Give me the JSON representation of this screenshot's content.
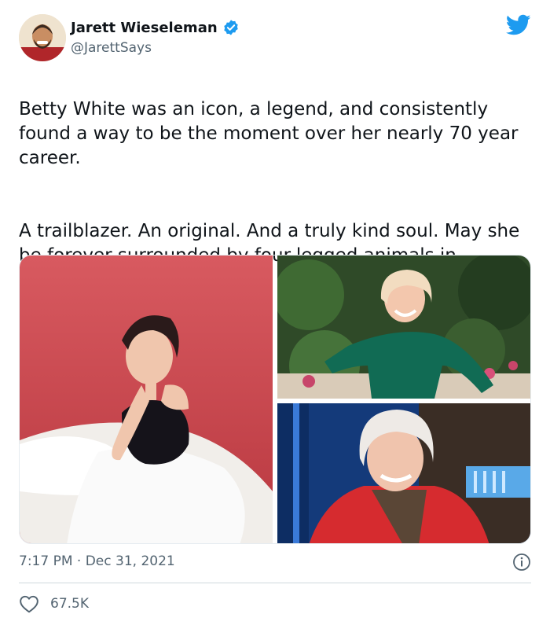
{
  "author": {
    "display_name": "Jarett Wieseleman",
    "handle": "@JarettSays",
    "verified": true,
    "avatar_icon": "avatar-photo"
  },
  "brand": {
    "icon": "twitter-bird-icon",
    "color": "#1d9bf0"
  },
  "tweet": {
    "paragraph_1": "Betty White was an icon, a legend, and consistently found a way to be the moment over her nearly 70 year career.",
    "paragraph_2": "A trailblazer. An original. And a truly kind soul. May she be forever surrounded by four-legged animals in heaven."
  },
  "media": {
    "photos": [
      {
        "name": "photo-betty-white-red-backdrop"
      },
      {
        "name": "photo-betty-white-green-outfit"
      },
      {
        "name": "photo-betty-white-red-jacket"
      }
    ]
  },
  "footer": {
    "time": "7:17 PM",
    "separator": "·",
    "date": "Dec 31, 2021",
    "likes": "67.5K"
  },
  "colors": {
    "text": "#0f1419",
    "secondary": "#536471",
    "divider": "#cfd9de",
    "verified": "#1d9bf0"
  }
}
